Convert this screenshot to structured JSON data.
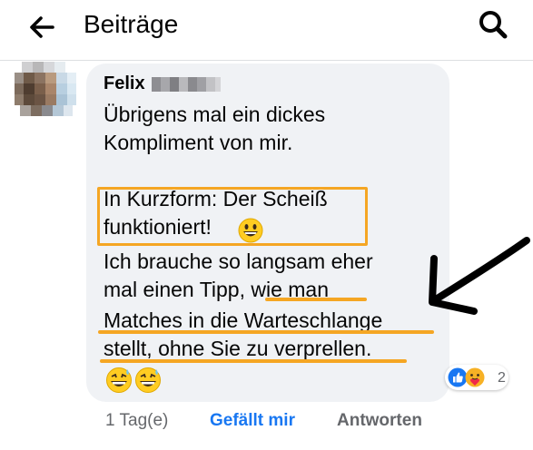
{
  "header": {
    "title": "Beiträge",
    "back_icon": "arrow-left-icon",
    "search_icon": "search-icon"
  },
  "comment": {
    "author": "Felix",
    "lines": [
      "Übrigens mal ein dickes",
      "Kompliment von mir.",
      "In Kurzform: Der Scheiß",
      "funktioniert!",
      "Ich brauche so langsam eher",
      "mal einen Tipp, wie man",
      "Matches in die Warteschlange",
      "stellt, ohne Sie zu verprellen."
    ],
    "emojis": [
      "grinning-face-emoji",
      "grinning-sweat-emoji",
      "grinning-sweat-emoji"
    ],
    "reactions": {
      "icons": [
        "like-reaction-icon",
        "care-reaction-icon"
      ],
      "count": "2"
    },
    "time": "1 Tag(e)",
    "like_label": "Gefällt mir",
    "reply_label": "Antworten"
  },
  "annotation": {
    "highlight_color": "#f5a623",
    "arrow_color": "#000000"
  }
}
